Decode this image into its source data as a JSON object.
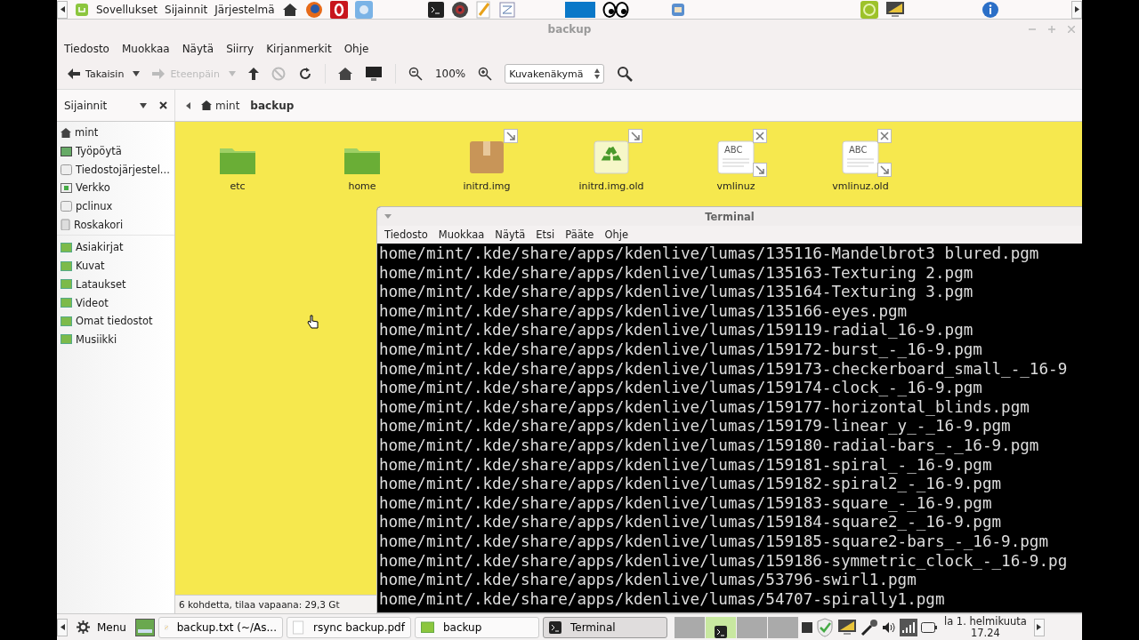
{
  "top_panel": {
    "menus": [
      "Sovellukset",
      "Sijainnit",
      "Järjestelmä"
    ]
  },
  "window": {
    "title": "backup"
  },
  "menu": [
    "Tiedosto",
    "Muokkaa",
    "Näytä",
    "Siirry",
    "Kirjanmerkit",
    "Ohje"
  ],
  "toolbar": {
    "back": "Takaisin",
    "forward": "Eteenpäin",
    "forward_disabled": true,
    "zoom": "100%",
    "view": "Kuvakenäkymä"
  },
  "sidebar": {
    "title": "Sijainnit",
    "groups": [
      [
        {
          "label": "mint",
          "kind": "home"
        },
        {
          "label": "Työpöytä",
          "kind": "desktop"
        },
        {
          "label": "Tiedostojärjestel...",
          "kind": "drive"
        },
        {
          "label": "Verkko",
          "kind": "network"
        },
        {
          "label": "pclinux",
          "kind": "drive"
        },
        {
          "label": "Roskakori",
          "kind": "trash"
        }
      ],
      [
        {
          "label": "Asiakirjat",
          "kind": "folder"
        },
        {
          "label": "Kuvat",
          "kind": "folder"
        },
        {
          "label": "Lataukset",
          "kind": "folder"
        },
        {
          "label": "Videot",
          "kind": "folder"
        },
        {
          "label": "Omat tiedostot",
          "kind": "folder"
        },
        {
          "label": "Musiikki",
          "kind": "folder"
        }
      ]
    ]
  },
  "breadcrumb": [
    {
      "label": "mint",
      "selected": false
    },
    {
      "label": "backup",
      "selected": true
    }
  ],
  "files": [
    {
      "name": "etc",
      "kind": "folder",
      "link": false,
      "broken": false
    },
    {
      "name": "home",
      "kind": "folder",
      "link": false,
      "broken": false
    },
    {
      "name": "initrd.img",
      "kind": "package",
      "link": true,
      "broken": false
    },
    {
      "name": "initrd.img.old",
      "kind": "recycle",
      "link": true,
      "broken": false
    },
    {
      "name": "vmlinuz",
      "kind": "text",
      "icon_text": "ABC",
      "link": true,
      "broken": true
    },
    {
      "name": "vmlinuz.old",
      "kind": "text",
      "icon_text": "ABC",
      "link": true,
      "broken": true
    }
  ],
  "status": "6 kohdetta, tilaa vapaana: 29,3 Gt",
  "terminal": {
    "title": "Terminal",
    "menu": [
      "Tiedosto",
      "Muokkaa",
      "Näytä",
      "Etsi",
      "Pääte",
      "Ohje"
    ],
    "lines": [
      "home/mint/.kde/share/apps/kdenlive/lumas/135116-Mandelbrot3 blured.pgm",
      "home/mint/.kde/share/apps/kdenlive/lumas/135163-Texturing 2.pgm",
      "home/mint/.kde/share/apps/kdenlive/lumas/135164-Texturing 3.pgm",
      "home/mint/.kde/share/apps/kdenlive/lumas/135166-eyes.pgm",
      "home/mint/.kde/share/apps/kdenlive/lumas/159119-radial_16-9.pgm",
      "home/mint/.kde/share/apps/kdenlive/lumas/159172-burst_-_16-9.pgm",
      "home/mint/.kde/share/apps/kdenlive/lumas/159173-checkerboard_small_-_16-9",
      "home/mint/.kde/share/apps/kdenlive/lumas/159174-clock_-_16-9.pgm",
      "home/mint/.kde/share/apps/kdenlive/lumas/159177-horizontal_blinds.pgm",
      "home/mint/.kde/share/apps/kdenlive/lumas/159179-linear_y_-_16-9.pgm",
      "home/mint/.kde/share/apps/kdenlive/lumas/159180-radial-bars_-_16-9.pgm",
      "home/mint/.kde/share/apps/kdenlive/lumas/159181-spiral_-_16-9.pgm",
      "home/mint/.kde/share/apps/kdenlive/lumas/159182-spiral2_-_16-9.pgm",
      "home/mint/.kde/share/apps/kdenlive/lumas/159183-square_-_16-9.pgm",
      "home/mint/.kde/share/apps/kdenlive/lumas/159184-square2_-_16-9.pgm",
      "home/mint/.kde/share/apps/kdenlive/lumas/159185-square2-bars_-_16-9.pgm",
      "home/mint/.kde/share/apps/kdenlive/lumas/159186-symmetric_clock_-_16-9.pg",
      "home/mint/.kde/share/apps/kdenlive/lumas/53796-swirl1.pgm",
      "home/mint/.kde/share/apps/kdenlive/lumas/54707-spirally1.pgm"
    ]
  },
  "taskbar": {
    "menu": "Menu",
    "tasks": [
      {
        "label": "backup.txt (~/As...",
        "kind": "text",
        "selected": false
      },
      {
        "label": "rsync backup.pdf",
        "kind": "document",
        "selected": false
      },
      {
        "label": "backup",
        "kind": "folder",
        "selected": false
      },
      {
        "label": "Terminal",
        "kind": "terminal",
        "selected": true
      }
    ],
    "clock": [
      "la 1. helmikuuta",
      "17.24"
    ]
  }
}
